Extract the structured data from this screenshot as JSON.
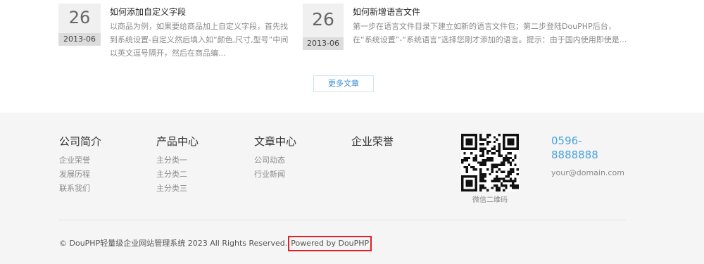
{
  "articles": [
    {
      "day": "26",
      "ym": "2013-06",
      "title": "如何添加自定义字段",
      "desc": "以商品为例，如果要给商品加上自定义字段，首先找到系统设置-自定义然后填入如“颜色,尺寸,型号”中间以英文逗号隔开，然后在商品编..."
    },
    {
      "day": "26",
      "ym": "2013-06",
      "title": "如何新增语言文件",
      "desc": "第一步在语言文件目录下建立如新的语言文件包；第二步登陆DouPHP后台，在“系统设置”-“系统语言”选择您刚才添加的语言。提示：由于国内使用即使是..."
    }
  ],
  "more_label": "更多文章",
  "footer": {
    "cols": [
      {
        "title": "公司简介",
        "items": [
          "企业荣誉",
          "发展历程",
          "联系我们"
        ]
      },
      {
        "title": "产品中心",
        "items": [
          "主分类一",
          "主分类二",
          "主分类三"
        ]
      },
      {
        "title": "文章中心",
        "items": [
          "公司动态",
          "行业新闻"
        ]
      },
      {
        "title": "企业荣誉",
        "items": []
      }
    ],
    "qr_caption": "微信二维码",
    "phone": "0596-8888888",
    "email": "your@domain.com",
    "copyright": "© DouPHP轻量级企业网站管理系统 2023 All Rights Reserved.",
    "powered": "Powered by DouPHP"
  }
}
